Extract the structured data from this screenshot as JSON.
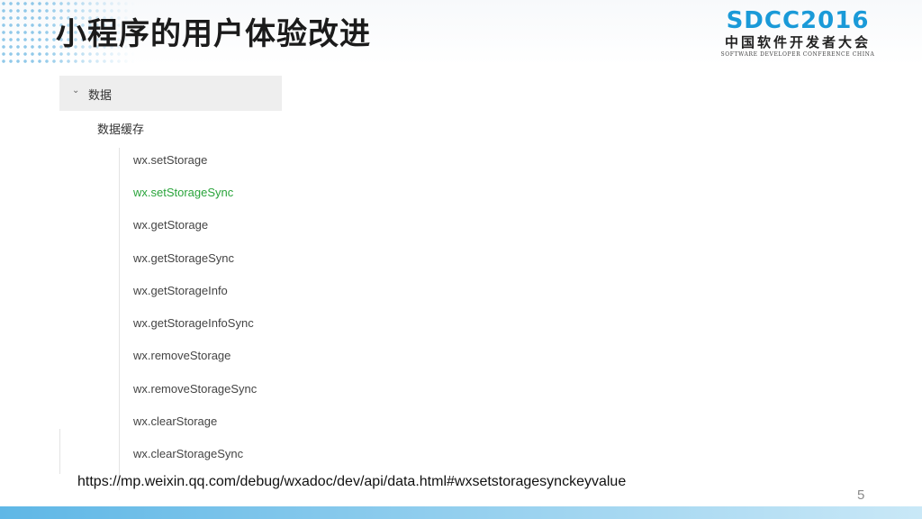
{
  "slide": {
    "title": "小程序的用户体验改进",
    "page_number": "5",
    "url": "https://mp.weixin.qq.com/debug/wxadoc/dev/api/data.html#wxsetstoragesynckeyvalue"
  },
  "logo": {
    "main": "SDCC2016",
    "cn": "中国软件开发者大会",
    "en": "SOFTWARE DEVELOPER CONFERENCE CHINA"
  },
  "tree": {
    "group_label": "数据",
    "subgroup_label": "数据缓存",
    "items": [
      {
        "label": "wx.setStorage"
      },
      {
        "label": "wx.setStorageSync"
      },
      {
        "label": "wx.getStorage"
      },
      {
        "label": "wx.getStorageSync"
      },
      {
        "label": "wx.getStorageInfo"
      },
      {
        "label": "wx.getStorageInfoSync"
      },
      {
        "label": "wx.removeStorage"
      },
      {
        "label": "wx.removeStorageSync"
      },
      {
        "label": "wx.clearStorage"
      },
      {
        "label": "wx.clearStorageSync"
      }
    ]
  },
  "colors": {
    "active_item": "#2aa43b",
    "logo_blue": "#1a9ad8",
    "footer_bar": "#5fb7e6"
  },
  "icons": {
    "group_toggle": "chevron-down-icon"
  }
}
